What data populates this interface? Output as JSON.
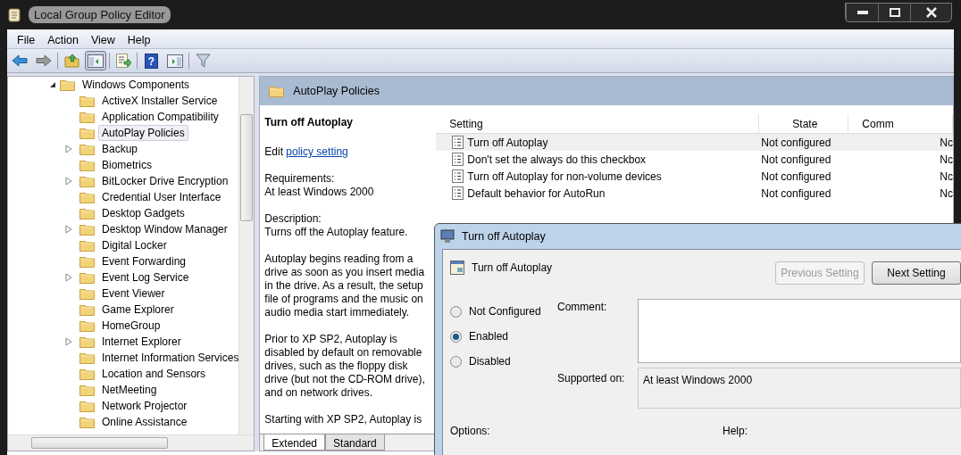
{
  "window": {
    "title": "Local Group Policy Editor"
  },
  "menu": [
    "File",
    "Action",
    "View",
    "Help"
  ],
  "toolbar": [
    {
      "kind": "back",
      "pressed": false
    },
    {
      "kind": "forward",
      "pressed": false
    },
    {
      "kind": "up",
      "pressed": false
    },
    {
      "kind": "tree",
      "pressed": true
    },
    {
      "kind": "export",
      "pressed": false
    },
    {
      "kind": "help",
      "pressed": false,
      "glyph": "?"
    },
    {
      "kind": "action-pane",
      "pressed": false
    },
    {
      "kind": "filter",
      "pressed": false
    }
  ],
  "tree": {
    "label": "Windows Components",
    "expanded": true,
    "children": [
      {
        "label": "ActiveX Installer Service",
        "expandable": false,
        "selected": false
      },
      {
        "label": "Application Compatibility",
        "expandable": false,
        "selected": false
      },
      {
        "label": "AutoPlay Policies",
        "expandable": false,
        "selected": true
      },
      {
        "label": "Backup",
        "expandable": true,
        "selected": false
      },
      {
        "label": "Biometrics",
        "expandable": false,
        "selected": false
      },
      {
        "label": "BitLocker Drive Encryption",
        "expandable": true,
        "selected": false
      },
      {
        "label": "Credential User Interface",
        "expandable": false,
        "selected": false
      },
      {
        "label": "Desktop Gadgets",
        "expandable": false,
        "selected": false
      },
      {
        "label": "Desktop Window Manager",
        "expandable": true,
        "selected": false
      },
      {
        "label": "Digital Locker",
        "expandable": false,
        "selected": false
      },
      {
        "label": "Event Forwarding",
        "expandable": false,
        "selected": false
      },
      {
        "label": "Event Log Service",
        "expandable": true,
        "selected": false
      },
      {
        "label": "Event Viewer",
        "expandable": false,
        "selected": false
      },
      {
        "label": "Game Explorer",
        "expandable": false,
        "selected": false
      },
      {
        "label": "HomeGroup",
        "expandable": false,
        "selected": false
      },
      {
        "label": "Internet Explorer",
        "expandable": true,
        "selected": false
      },
      {
        "label": "Internet Information Services",
        "expandable": false,
        "selected": false
      },
      {
        "label": "Location and Sensors",
        "expandable": false,
        "selected": false
      },
      {
        "label": "NetMeeting",
        "expandable": false,
        "selected": false
      },
      {
        "label": "Network Projector",
        "expandable": false,
        "selected": false
      },
      {
        "label": "Online Assistance",
        "expandable": false,
        "selected": false
      }
    ]
  },
  "pane_header": "AutoPlay Policies",
  "description": {
    "title": "Turn off Autoplay",
    "edit_prefix": "Edit",
    "edit_link": "policy setting",
    "paragraphs": [
      "Requirements:\nAt least Windows 2000",
      "Description:\nTurns off the Autoplay feature.",
      "Autoplay begins reading from a drive as soon as you insert media in the drive. As a result, the setup file of programs and the music on audio media start immediately.",
      "Prior to XP SP2, Autoplay is disabled by default on removable drives, such as the floppy disk drive (but not the CD-ROM drive), and on network drives.",
      "Starting with XP SP2, Autoplay is"
    ]
  },
  "view_tabs": [
    {
      "label": "Extended",
      "selected": true
    },
    {
      "label": "Standard",
      "selected": false
    }
  ],
  "table": {
    "columns": [
      "Setting",
      "State",
      "Comm"
    ],
    "rows": [
      {
        "setting": "Turn off Autoplay",
        "state": "Not configured",
        "column_3": "Nc",
        "selected": true
      },
      {
        "setting": "Don't set the always do this checkbox",
        "state": "Not configured",
        "column_3": "Nc",
        "selected": false
      },
      {
        "setting": "Turn off Autoplay for non-volume devices",
        "state": "Not configured",
        "column_3": "Nc",
        "selected": false
      },
      {
        "setting": "Default behavior for AutoRun",
        "state": "Not configured",
        "column_3": "Nc",
        "selected": false
      }
    ]
  },
  "dialog": {
    "title": "Turn off Autoplay",
    "heading": "Turn off Autoplay",
    "buttons": [
      {
        "label": "Previous Setting",
        "disabled": true
      },
      {
        "label": "Next Setting",
        "disabled": false
      }
    ],
    "options": [
      {
        "label": "Not Configured",
        "selected": false
      },
      {
        "label": "Enabled",
        "selected": true
      },
      {
        "label": "Disabled",
        "selected": false
      }
    ],
    "comment_label": "Comment:",
    "supported_label": "Supported on:",
    "supported_value": "At least Windows 2000",
    "options_label": "Options:",
    "help_label": "Help:"
  }
}
